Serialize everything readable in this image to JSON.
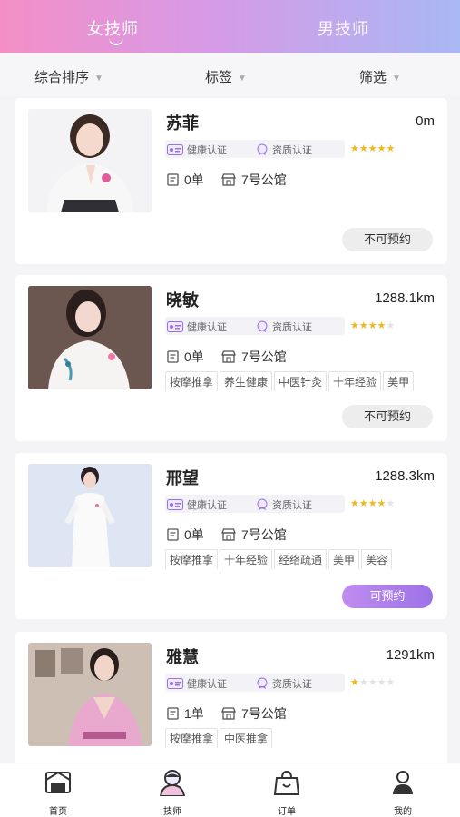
{
  "tabs": {
    "female": "女技师",
    "male": "男技师"
  },
  "filters": {
    "sort": "综合排序",
    "tags": "标签",
    "filter": "筛选"
  },
  "cards": [
    {
      "name": "苏菲",
      "distance": "0m",
      "cert_health": "健康认证",
      "cert_qual": "资质认证",
      "rating": 5,
      "orders": "0单",
      "location": "7号公馆",
      "tags": [],
      "button": "不可预约",
      "available": false
    },
    {
      "name": "晓敏",
      "distance": "1288.1km",
      "cert_health": "健康认证",
      "cert_qual": "资质认证",
      "rating": 4,
      "orders": "0单",
      "location": "7号公馆",
      "tags": [
        "按摩推拿",
        "养生健康",
        "中医针灸",
        "十年经验",
        "美甲"
      ],
      "button": "不可预约",
      "available": false
    },
    {
      "name": "邢望",
      "distance": "1288.3km",
      "cert_health": "健康认证",
      "cert_qual": "资质认证",
      "rating": 4,
      "orders": "0单",
      "location": "7号公馆",
      "tags": [
        "按摩推拿",
        "十年经验",
        "经络疏通",
        "美甲",
        "美容"
      ],
      "button": "可预约",
      "available": true
    },
    {
      "name": "雅慧",
      "distance": "1291km",
      "cert_health": "健康认证",
      "cert_qual": "资质认证",
      "rating": 1,
      "orders": "1单",
      "location": "7号公馆",
      "tags": [
        "按摩推拿",
        "中医推拿"
      ],
      "button": "",
      "available": true
    }
  ],
  "nav": {
    "home": "首页",
    "tech": "技师",
    "orders": "订单",
    "mine": "我的"
  },
  "colors": {
    "accent": "#9b72e6",
    "star": "#f2b61d",
    "header_left": "#f48fc6",
    "header_right": "#a8b8f4"
  }
}
